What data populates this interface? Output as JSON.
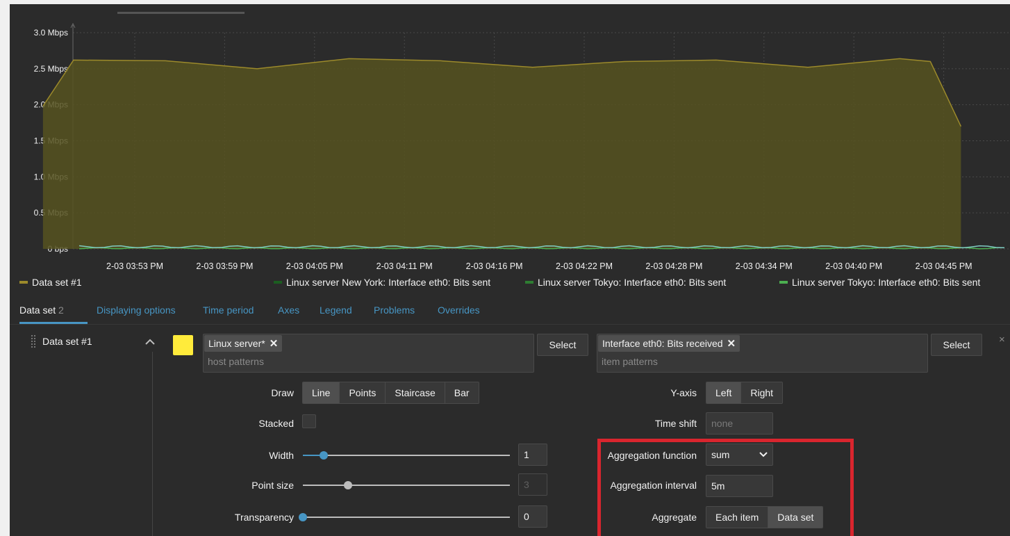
{
  "chart_data": {
    "type": "area",
    "x": [
      "2-03 03:47 PM",
      "2-03 03:49 PM",
      "2-03 03:55 PM",
      "2-03 04:01 PM",
      "2-03 04:07 PM",
      "2-03 04:13 PM",
      "2-03 04:19 PM",
      "2-03 04:25 PM",
      "2-03 04:31 PM",
      "2-03 04:37 PM",
      "2-03 04:43 PM",
      "2-03 04:45 PM",
      "2-03 04:47 PM"
    ],
    "series": [
      {
        "name": "Data set #1",
        "values": [
          1.98,
          2.62,
          2.61,
          2.5,
          2.64,
          2.61,
          2.52,
          2.6,
          2.62,
          2.52,
          2.64,
          2.6,
          1.7
        ]
      }
    ],
    "ylim": [
      0,
      3.0
    ],
    "yticks": [
      "0 bps",
      "0.5 Mbps",
      "1.0 Mbps",
      "1.5 Mbps",
      "2.0 Mbps",
      "2.5 Mbps",
      "3.0 Mbps"
    ],
    "xticks": [
      "2-03 03:53 PM",
      "2-03 03:59 PM",
      "2-03 04:05 PM",
      "2-03 04:11 PM",
      "2-03 04:16 PM",
      "2-03 04:22 PM",
      "2-03 04:28 PM",
      "2-03 04:34 PM",
      "2-03 04:40 PM",
      "2-03 04:45 PM"
    ],
    "grid": true,
    "legend": "bottom"
  },
  "legend": [
    {
      "label": "Data set #1",
      "color": "#9c8a2b"
    },
    {
      "label": "Linux server New York: Interface eth0: Bits sent",
      "color": "#1b5e20"
    },
    {
      "label": "Linux server Tokyo: Interface eth0: Bits sent",
      "color": "#2e7d32"
    },
    {
      "label": "Linux server Tokyo: Interface eth0: Bits sent",
      "color": "#4caf50"
    }
  ],
  "colors": {
    "area_fill": "#565220",
    "area_line": "#9c8a2b",
    "low_line_1": "#80cbc4",
    "low_line_2": "#4caf50",
    "accent": "#4796c4",
    "dataset_color": "#ffeb3b",
    "highlight": "#d9252e"
  },
  "tabs": [
    {
      "label": "Data set",
      "count": "2"
    },
    {
      "label": "Displaying options"
    },
    {
      "label": "Time period"
    },
    {
      "label": "Axes"
    },
    {
      "label": "Legend"
    },
    {
      "label": "Problems"
    },
    {
      "label": "Overrides"
    }
  ],
  "dataset": {
    "title": "Data set #1",
    "host_chip": "Linux server*",
    "host_placeholder": "host patterns",
    "item_chip": "Interface eth0: Bits received",
    "item_placeholder": "item patterns",
    "select_label": "Select",
    "close_icon": "×",
    "chip_x": "✕",
    "draw_label": "Draw",
    "draw_options": [
      "Line",
      "Points",
      "Staircase",
      "Bar"
    ],
    "draw_selected": "Line",
    "stacked_label": "Stacked",
    "width_label": "Width",
    "width_value": "1",
    "width_level": 0.1,
    "point_size_label": "Point size",
    "point_size_value": "3",
    "point_size_level": 0.2,
    "transparency_label": "Transparency",
    "transparency_value": "0",
    "transparency_level": 0,
    "yaxis_label": "Y-axis",
    "yaxis_options": [
      "Left",
      "Right"
    ],
    "yaxis_selected": "Left",
    "time_shift_label": "Time shift",
    "time_shift_placeholder": "none",
    "agg_function_label": "Aggregation function",
    "agg_function_value": "sum",
    "agg_interval_label": "Aggregation interval",
    "agg_interval_value": "5m",
    "aggregate_label": "Aggregate",
    "aggregate_options": [
      "Each item",
      "Data set"
    ],
    "aggregate_selected": "Data set"
  }
}
